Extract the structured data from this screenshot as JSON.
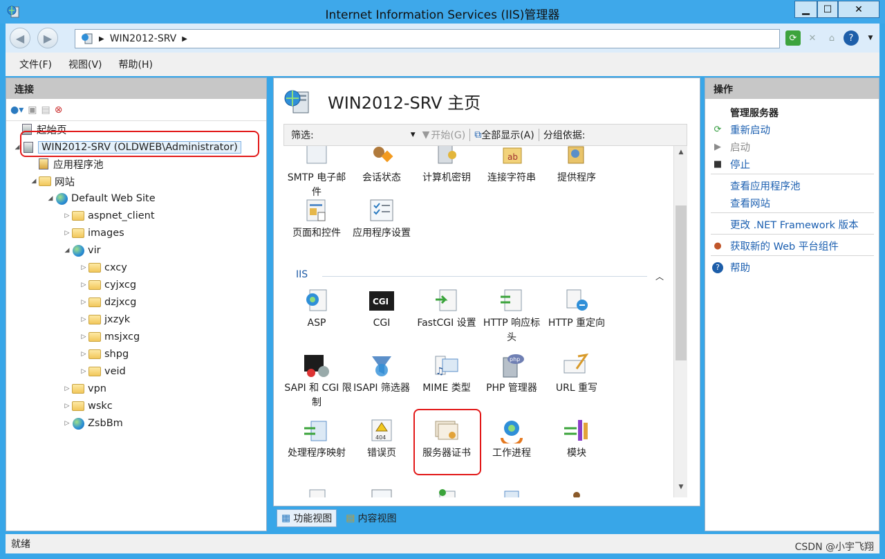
{
  "window": {
    "title": "Internet Information Services (IIS)管理器"
  },
  "address": {
    "crumbs": [
      "WIN2012-SRV"
    ]
  },
  "menu": {
    "file": "文件(F)",
    "view": "视图(V)",
    "help": "帮助(H)"
  },
  "left": {
    "title": "连接",
    "tree": [
      {
        "label": "起始页",
        "icon": "start-page-icon"
      },
      {
        "label": "WIN2012-SRV (OLDWEB\\Administrator)",
        "icon": "server-icon"
      },
      {
        "label": "应用程序池",
        "icon": "app-pool-icon"
      },
      {
        "label": "网站",
        "icon": "sites-icon"
      },
      {
        "label": "Default Web Site",
        "icon": "globe-icon"
      },
      {
        "label": "aspnet_client",
        "icon": "folder-icon"
      },
      {
        "label": "images",
        "icon": "folder-icon"
      },
      {
        "label": "vir",
        "icon": "globe-icon"
      },
      {
        "label": "cxcy",
        "icon": "folder-icon"
      },
      {
        "label": "cyjxcg",
        "icon": "folder-icon"
      },
      {
        "label": "dzjxcg",
        "icon": "folder-icon"
      },
      {
        "label": "jxzyk",
        "icon": "folder-icon"
      },
      {
        "label": "msjxcg",
        "icon": "folder-icon"
      },
      {
        "label": "shpg",
        "icon": "folder-icon"
      },
      {
        "label": "veid",
        "icon": "folder-icon"
      },
      {
        "label": "vpn",
        "icon": "folder-icon"
      },
      {
        "label": "wskc",
        "icon": "folder-icon"
      },
      {
        "label": "ZsbBm",
        "icon": "globe-icon"
      }
    ]
  },
  "center": {
    "title": "WIN2012-SRV 主页",
    "filter": {
      "label": "筛选:",
      "start": "开始(G)",
      "show_all": "全部显示(A)",
      "group_by": "分组依据:"
    },
    "group_iis": "IIS",
    "features_top": [
      "SMTP 电子邮件",
      "会话状态",
      "计算机密钥",
      "连接字符串",
      "提供程序",
      "页面和控件",
      "应用程序设置"
    ],
    "features_iis": [
      "ASP",
      "CGI",
      "FastCGI 设置",
      "HTTP 响应标头",
      "HTTP 重定向",
      "ISAPI 和 CGI 限制",
      "ISAPI 筛选器",
      "MIME 类型",
      "PHP 管理器",
      "URL 重写",
      "处理程序映射",
      "错误页",
      "服务器证书",
      "工作进程",
      "模块"
    ],
    "tabs": {
      "features": "功能视图",
      "content": "内容视图"
    }
  },
  "right": {
    "title": "操作",
    "section": "管理服务器",
    "actions": [
      {
        "label": "重新启动",
        "enabled": true
      },
      {
        "label": "启动",
        "enabled": false
      },
      {
        "label": "停止",
        "enabled": true
      },
      {
        "label": "查看应用程序池",
        "enabled": true
      },
      {
        "label": "查看网站",
        "enabled": true
      },
      {
        "label": "更改 .NET Framework 版本",
        "enabled": true
      },
      {
        "label": "获取新的 Web 平台组件",
        "enabled": true
      },
      {
        "label": "帮助",
        "enabled": true
      }
    ]
  },
  "status": {
    "text": "就绪"
  },
  "watermark": "CSDN @小宇飞翔",
  "colors": {
    "accent": "#1b5fb0",
    "highlight_border": "#e21818",
    "title_bar": "#3ea8ea"
  }
}
